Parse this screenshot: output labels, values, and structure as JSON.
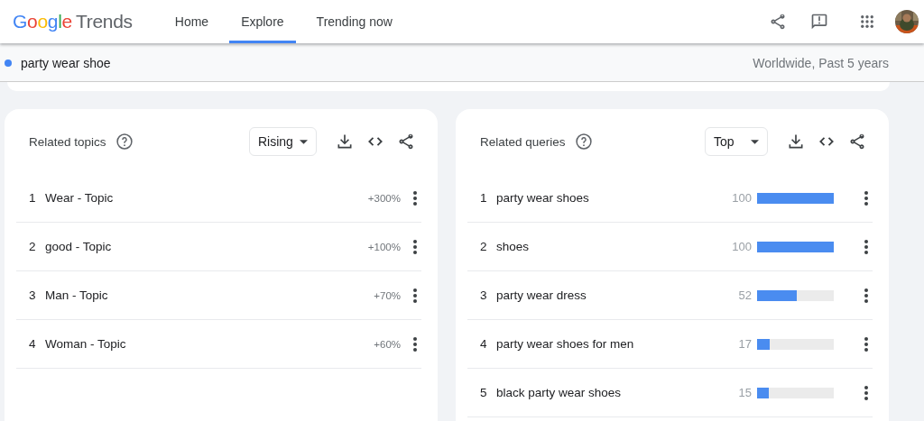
{
  "header": {
    "logo": {
      "brand": "Google",
      "product": "Trends"
    },
    "nav": [
      {
        "label": "Home",
        "selected": false
      },
      {
        "label": "Explore",
        "selected": true
      },
      {
        "label": "Trending now",
        "selected": false
      }
    ]
  },
  "search": {
    "term": "party wear shoe",
    "color": "#4285f4",
    "scope": "Worldwide, Past 5 years"
  },
  "panels": [
    {
      "kind": "topics",
      "title": "Related topics",
      "filter": "Rising",
      "rows": [
        {
          "rank": "1",
          "label": "Wear - Topic",
          "value": "+300%"
        },
        {
          "rank": "2",
          "label": "good - Topic",
          "value": "+100%"
        },
        {
          "rank": "3",
          "label": "Man - Topic",
          "value": "+70%"
        },
        {
          "rank": "4",
          "label": "Woman - Topic",
          "value": "+60%"
        }
      ]
    },
    {
      "kind": "queries",
      "title": "Related queries",
      "filter": "Top",
      "rows": [
        {
          "rank": "1",
          "label": "party wear shoes",
          "value": "100",
          "level": 1
        },
        {
          "rank": "2",
          "label": "shoes",
          "value": "100",
          "level": 1
        },
        {
          "rank": "3",
          "label": "party wear dress",
          "value": "52",
          "level": 0.52
        },
        {
          "rank": "4",
          "label": "party wear shoes for men",
          "value": "17",
          "level": 0.17
        },
        {
          "rank": "5",
          "label": "black party wear shoes",
          "value": "15",
          "level": 0.15
        }
      ]
    }
  ]
}
